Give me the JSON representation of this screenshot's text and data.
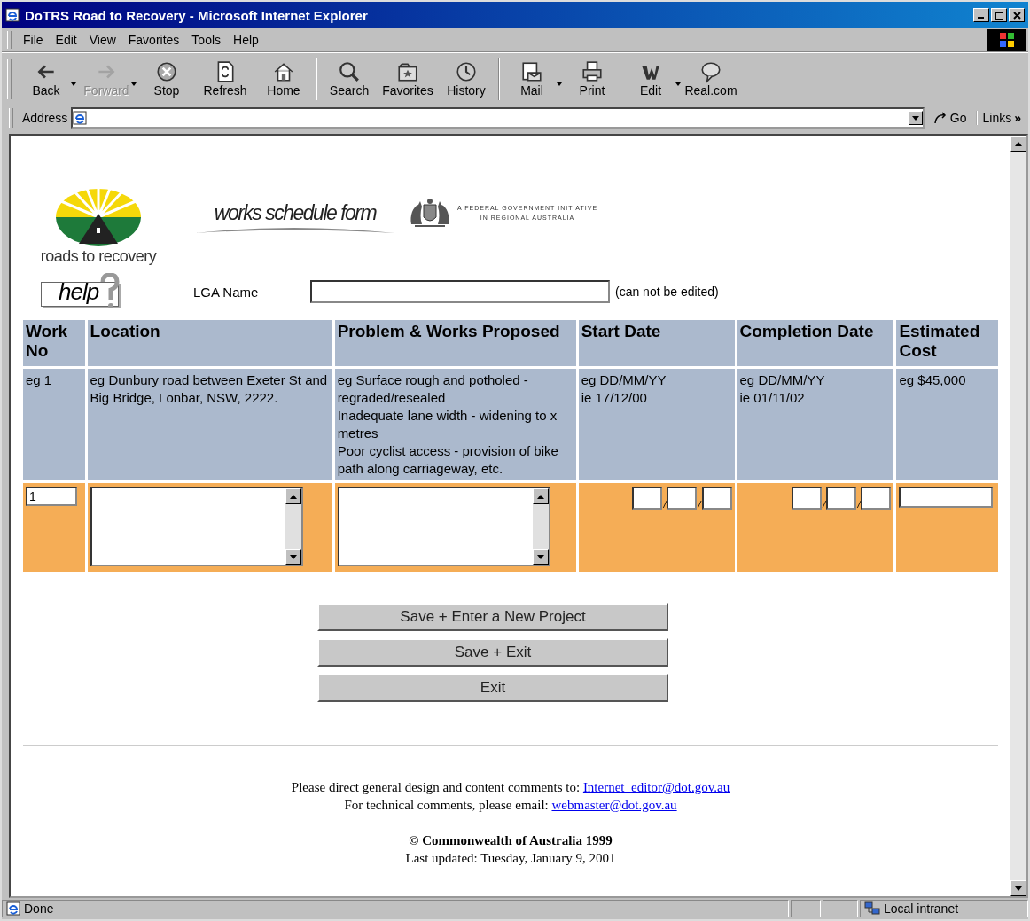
{
  "window": {
    "title": "DoTRS Road to Recovery - Microsoft Internet Explorer"
  },
  "menu": [
    "File",
    "Edit",
    "View",
    "Favorites",
    "Tools",
    "Help"
  ],
  "toolbar_groups": [
    [
      {
        "label": "Back",
        "disabled": false,
        "dropdown": true
      },
      {
        "label": "Forward",
        "disabled": true,
        "dropdown": true
      },
      {
        "label": "Stop",
        "disabled": false,
        "dropdown": false
      },
      {
        "label": "Refresh",
        "disabled": false,
        "dropdown": false
      },
      {
        "label": "Home",
        "disabled": false,
        "dropdown": false
      }
    ],
    [
      {
        "label": "Search",
        "disabled": false,
        "dropdown": false
      },
      {
        "label": "Favorites",
        "disabled": false,
        "dropdown": false
      },
      {
        "label": "History",
        "disabled": false,
        "dropdown": false
      }
    ],
    [
      {
        "label": "Mail",
        "disabled": false,
        "dropdown": true
      },
      {
        "label": "Print",
        "disabled": false,
        "dropdown": false
      },
      {
        "label": "Edit",
        "disabled": false,
        "dropdown": true
      },
      {
        "label": "Real.com",
        "disabled": false,
        "dropdown": false
      }
    ]
  ],
  "address_bar": {
    "label": "Address",
    "go": "Go",
    "links": "Links",
    "links_more": "»"
  },
  "page": {
    "logo_caption": "roads to recovery",
    "form_title": "works schedule form",
    "initiative": [
      "A FEDERAL GOVERNMENT INITIATIVE",
      "IN REGIONAL AUSTRALIA"
    ],
    "help_button": "help",
    "lga": {
      "label": "LGA Name",
      "note": "(can not be edited)"
    },
    "table": {
      "columns": [
        "Work No",
        "Location",
        "Problem & Works Proposed",
        "Start Date",
        "Completion Date",
        "Estimated Cost"
      ],
      "example_row": [
        [
          "eg 1"
        ],
        [
          "eg Dunbury road between Exeter St and Big Bridge, Lonbar, NSW, 2222."
        ],
        [
          "eg Surface rough and potholed - regraded/resealed",
          "Inadequate lane width - widening to x metres",
          "Poor cyclist access - provision of bike path along carriageway, etc."
        ],
        [
          "eg DD/MM/YY",
          "ie 17/12/00"
        ],
        [
          "eg DD/MM/YY",
          "ie 01/11/02"
        ],
        [
          "eg $45,000"
        ]
      ],
      "input_row": [
        {
          "kind": "short",
          "value": "1"
        },
        {
          "kind": "textarea"
        },
        {
          "kind": "textarea"
        },
        {
          "kind": "date",
          "separator": "/"
        },
        {
          "kind": "date",
          "separator": "/"
        },
        {
          "kind": "wide"
        }
      ]
    },
    "buttons": [
      "Save + Enter a New Project",
      "Save + Exit",
      "Exit"
    ],
    "footer": [
      {
        "text": "Please direct general design and content comments to:",
        "link": "Internet_editor@dot.gov.au"
      },
      {
        "text": "For technical comments, please email:",
        "link": "webmaster@dot.gov.au"
      }
    ],
    "copyright": "© Commonwealth of Australia 1999",
    "updated": "Last updated: Tuesday, January 9, 2001"
  },
  "status_bar": {
    "text": "Done",
    "zone": "Local intranet"
  }
}
